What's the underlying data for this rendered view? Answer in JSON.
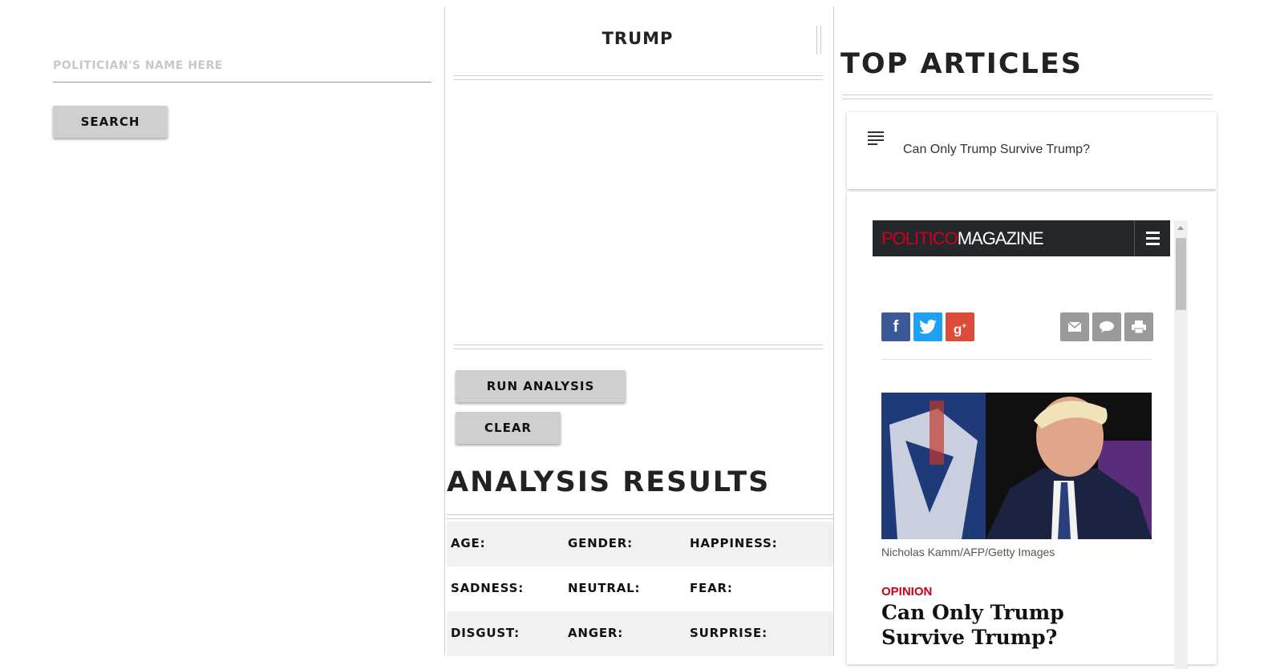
{
  "search": {
    "placeholder": "POLITICIAN'S NAME HERE",
    "button_label": "SEARCH"
  },
  "analysis": {
    "politician_name": "TRUMP",
    "run_label": "RUN ANALYSIS",
    "clear_label": "CLEAR",
    "results_title": "ANALYSIS RESULTS",
    "rows": [
      [
        "AGE:",
        "GENDER:",
        "HAPPINESS:"
      ],
      [
        "SADNESS:",
        "NEUTRAL:",
        "FEAR:"
      ],
      [
        "DISGUST:",
        "ANGER:",
        "SURPRISE:"
      ]
    ]
  },
  "articles": {
    "title": "TOP ARTICLES",
    "items": [
      {
        "title": "Can Only Trump Survive Trump?",
        "embed": {
          "brand_red": "POLITICO",
          "brand_white": "MAGAZINE",
          "photo_credit": "Nicholas Kamm/AFP/Getty Images",
          "section": "OPINION",
          "headline": "Can Only Trump Survive Trump?"
        }
      }
    ]
  },
  "icons": {
    "list": "list-icon",
    "menu": "hamburger-menu-icon",
    "facebook": "facebook-icon",
    "twitter": "twitter-icon",
    "google_plus": "google-plus-icon",
    "email": "email-icon",
    "comment": "comment-icon",
    "print": "print-icon"
  },
  "colors": {
    "politico_red": "#d1001a",
    "facebook": "#3b5998",
    "twitter": "#1da1f2",
    "google_plus": "#dd4b39",
    "utility_gray": "#9a9a9a"
  }
}
